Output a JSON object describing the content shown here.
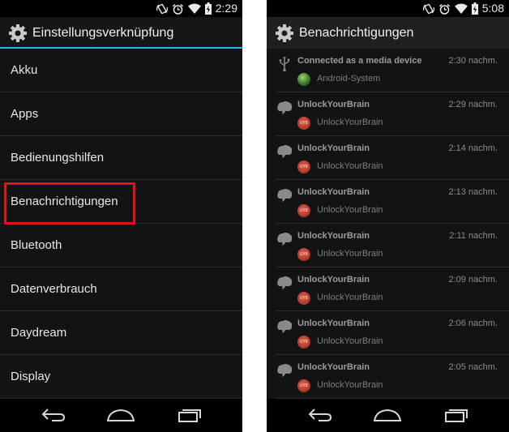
{
  "left_screen": {
    "status_time": "2:29",
    "title": "Einstellungsverknüpfung",
    "items": [
      {
        "label": "Akku"
      },
      {
        "label": "Apps"
      },
      {
        "label": "Bedienungshilfen"
      },
      {
        "label": "Benachrichtigungen",
        "highlighted": true
      },
      {
        "label": "Bluetooth"
      },
      {
        "label": "Datenverbrauch"
      },
      {
        "label": "Daydream"
      },
      {
        "label": "Display"
      }
    ]
  },
  "right_screen": {
    "status_time": "5:08",
    "title": "Benachrichtigungen",
    "notifications": [
      {
        "title": "Connected as a media device",
        "time": "2:30 nachm.",
        "app": "Android-System",
        "icon": "usb-icon"
      },
      {
        "title": "UnlockYourBrain",
        "time": "2:29 nachm.",
        "app": "UnlockYourBrain",
        "icon": "brain-icon"
      },
      {
        "title": "UnlockYourBrain",
        "time": "2:14 nachm.",
        "app": "UnlockYourBrain",
        "icon": "brain-icon"
      },
      {
        "title": "UnlockYourBrain",
        "time": "2:13 nachm.",
        "app": "UnlockYourBrain",
        "icon": "brain-icon"
      },
      {
        "title": "UnlockYourBrain",
        "time": "2:11 nachm.",
        "app": "UnlockYourBrain",
        "icon": "brain-icon"
      },
      {
        "title": "UnlockYourBrain",
        "time": "2:09 nachm.",
        "app": "UnlockYourBrain",
        "icon": "brain-icon"
      },
      {
        "title": "UnlockYourBrain",
        "time": "2:06 nachm.",
        "app": "UnlockYourBrain",
        "icon": "brain-icon"
      },
      {
        "title": "UnlockYourBrain",
        "time": "2:05 nachm.",
        "app": "UnlockYourBrain",
        "icon": "brain-icon"
      }
    ],
    "uyb_icon_text": "UYB"
  },
  "colors": {
    "accent": "#33b5e5",
    "highlight_border": "#e3101d",
    "background": "#111315"
  },
  "icons": [
    "settings-gear-icon",
    "rotate-icon",
    "alarm-icon",
    "wifi-icon",
    "battery-icon",
    "back-icon",
    "home-icon",
    "recent-apps-icon"
  ]
}
